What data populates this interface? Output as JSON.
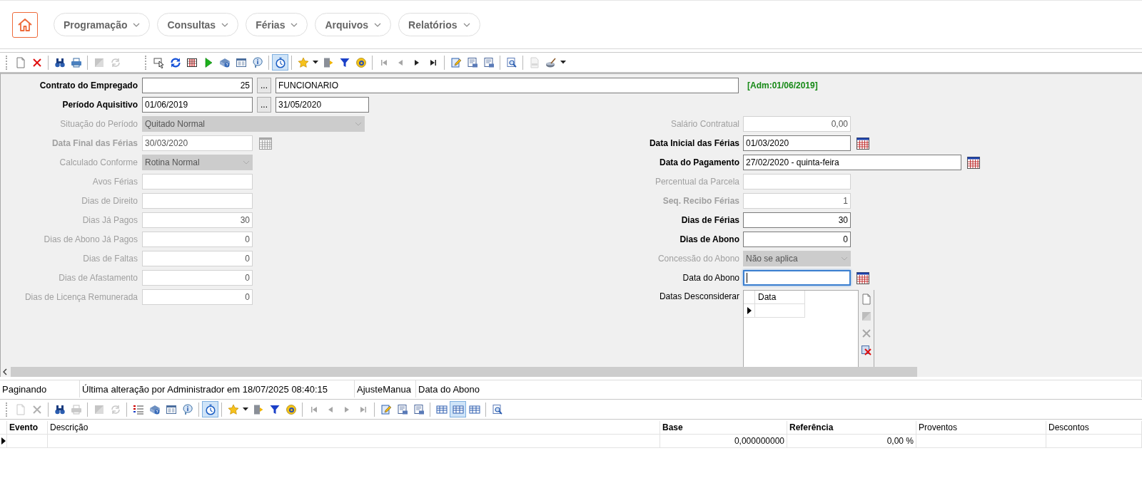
{
  "nav": {
    "menus": [
      "Programação",
      "Consultas",
      "Férias",
      "Arquivos",
      "Relatórios"
    ]
  },
  "main_toolbar": [
    {
      "kind": "new",
      "disabled": false,
      "pressed": false
    },
    {
      "kind": "delete",
      "disabled": false,
      "pressed": false
    },
    {
      "kind": "sep"
    },
    {
      "kind": "find",
      "disabled": false,
      "pressed": false
    },
    {
      "kind": "print",
      "disabled": false,
      "pressed": false
    },
    {
      "kind": "sep"
    },
    {
      "kind": "save",
      "disabled": true,
      "pressed": false
    },
    {
      "kind": "refresh",
      "disabled": true,
      "pressed": false
    },
    {
      "kind": "gap"
    },
    {
      "kind": "pointer",
      "disabled": false,
      "pressed": false
    },
    {
      "kind": "sync",
      "disabled": false,
      "pressed": false
    },
    {
      "kind": "columns",
      "disabled": false,
      "pressed": false
    },
    {
      "kind": "play",
      "disabled": false,
      "pressed": false
    },
    {
      "kind": "help",
      "disabled": false,
      "pressed": false
    },
    {
      "kind": "form",
      "disabled": false,
      "pressed": false
    },
    {
      "kind": "info",
      "disabled": false,
      "pressed": false
    },
    {
      "kind": "sep"
    },
    {
      "kind": "timer",
      "disabled": false,
      "pressed": true
    },
    {
      "kind": "sep"
    },
    {
      "kind": "star",
      "disabled": false,
      "pressed": false
    },
    {
      "kind": "caret",
      "disabled": false,
      "pressed": false
    },
    {
      "kind": "exit",
      "disabled": false,
      "pressed": false
    },
    {
      "kind": "filter",
      "disabled": false,
      "pressed": false
    },
    {
      "kind": "ring",
      "disabled": false,
      "pressed": false
    },
    {
      "kind": "sep"
    },
    {
      "kind": "first",
      "disabled": true,
      "pressed": false
    },
    {
      "kind": "prev",
      "disabled": true,
      "pressed": false
    },
    {
      "kind": "next",
      "disabled": false,
      "pressed": false
    },
    {
      "kind": "last",
      "disabled": false,
      "pressed": false
    },
    {
      "kind": "sep"
    },
    {
      "kind": "edit",
      "disabled": false,
      "pressed": false
    },
    {
      "kind": "report",
      "disabled": false,
      "pressed": false
    },
    {
      "kind": "report",
      "disabled": false,
      "pressed": false
    },
    {
      "kind": "sep"
    },
    {
      "kind": "preview",
      "disabled": false,
      "pressed": false
    },
    {
      "kind": "sep"
    },
    {
      "kind": "page",
      "disabled": true,
      "pressed": false
    },
    {
      "kind": "brush",
      "disabled": false,
      "pressed": false
    },
    {
      "kind": "caret",
      "disabled": false,
      "pressed": false
    }
  ],
  "form": {
    "top_rows": [
      {
        "label": "Contrato do Empregado",
        "kind": "lookup",
        "bold": true,
        "disabled": false,
        "value": "25",
        "button_label": "...",
        "description": "FUNCIONARIO",
        "note": "[Adm:01/06/2019]"
      },
      {
        "label": "Período Aquisitivo",
        "kind": "range",
        "bold": true,
        "disabled": false,
        "value": "01/06/2019",
        "button_label": "...",
        "value_end": "31/05/2020"
      }
    ],
    "left_rows": [
      {
        "label": "Situação do Período",
        "kind": "longcombo",
        "bold": false,
        "disabled": true,
        "value": "Quitado Normal"
      },
      {
        "label": "Data Final das Férias",
        "kind": "date",
        "bold": true,
        "disabled": true,
        "value": "30/03/2020"
      },
      {
        "label": "Calculado Conforme",
        "kind": "combo",
        "bold": false,
        "disabled": true,
        "value": "Rotina Normal"
      },
      {
        "label": "Avos Férias",
        "kind": "number",
        "bold": false,
        "disabled": true
      },
      {
        "label": "Dias de Direito",
        "kind": "number",
        "bold": false,
        "disabled": true
      },
      {
        "label": "Dias Já Pagos",
        "kind": "number",
        "bold": false,
        "disabled": true,
        "value": "30"
      },
      {
        "label": "Dias de Abono Já Pagos",
        "kind": "number",
        "bold": false,
        "disabled": true,
        "value": "0"
      },
      {
        "label": "Dias de Faltas",
        "kind": "number",
        "bold": false,
        "disabled": true,
        "value": "0"
      },
      {
        "label": "Dias de Afastamento",
        "kind": "number",
        "bold": false,
        "disabled": true,
        "value": "0"
      },
      {
        "label": "Dias de Licença Remunerada",
        "kind": "number",
        "bold": false,
        "disabled": true,
        "value": "0"
      }
    ],
    "right_rows": [
      {
        "label": "Salário Contratual",
        "kind": "number",
        "bold": false,
        "disabled": true,
        "value": "0,00"
      },
      {
        "label": "Data Inicial das Férias",
        "kind": "date",
        "bold": true,
        "disabled": false,
        "value": "01/03/2020"
      },
      {
        "label": "Data do Pagamento",
        "kind": "longdate",
        "bold": true,
        "disabled": false,
        "value": "27/02/2020 - quinta-feira"
      },
      {
        "label": "Percentual da Parcela",
        "kind": "number",
        "bold": false,
        "disabled": true
      },
      {
        "label": "Seq. Recibo Férias",
        "kind": "number",
        "bold": true,
        "disabled": true,
        "value": "1"
      },
      {
        "label": "Dias de Férias",
        "kind": "number",
        "bold": true,
        "disabled": false,
        "value": "30"
      },
      {
        "label": "Dias de Abono",
        "kind": "number",
        "bold": true,
        "disabled": false,
        "value": "0"
      },
      {
        "label": "Concessão do Abono",
        "kind": "combo",
        "bold": false,
        "disabled": true,
        "value": "Não se aplica"
      },
      {
        "label": "Data do Abono",
        "kind": "date",
        "bold": false,
        "disabled": false,
        "focused": true
      }
    ],
    "excluded_dates": {
      "label": "Datas Desconsiderar",
      "column": "Data",
      "rows": [
        {
          "current": true
        }
      ],
      "tools": [
        {
          "kind": "new",
          "disabled": false
        },
        {
          "kind": "save",
          "disabled": true
        },
        {
          "kind": "delete",
          "disabled": true
        },
        {
          "kind": "clear",
          "disabled": false
        }
      ]
    }
  },
  "status_bar": [
    "Paginando",
    "Última alteração por Administrador em 18/07/2025 08:40:15",
    "AjusteManua",
    "Data do Abono"
  ],
  "events_toolbar": [
    {
      "kind": "new",
      "disabled": true,
      "pressed": false
    },
    {
      "kind": "delete",
      "disabled": true,
      "pressed": false
    },
    {
      "kind": "sep"
    },
    {
      "kind": "find",
      "disabled": false,
      "pressed": false
    },
    {
      "kind": "print",
      "disabled": true,
      "pressed": false
    },
    {
      "kind": "sep"
    },
    {
      "kind": "save",
      "disabled": true,
      "pressed": false
    },
    {
      "kind": "refresh",
      "disabled": true,
      "pressed": false
    },
    {
      "kind": "sep"
    },
    {
      "kind": "list",
      "disabled": false,
      "pressed": false
    },
    {
      "kind": "help",
      "disabled": false,
      "pressed": false
    },
    {
      "kind": "form",
      "disabled": false,
      "pressed": false
    },
    {
      "kind": "info",
      "disabled": false,
      "pressed": false
    },
    {
      "kind": "sep"
    },
    {
      "kind": "timer",
      "disabled": false,
      "pressed": true
    },
    {
      "kind": "sep"
    },
    {
      "kind": "star",
      "disabled": false,
      "pressed": false
    },
    {
      "kind": "caret",
      "disabled": false,
      "pressed": false
    },
    {
      "kind": "exit",
      "disabled": false,
      "pressed": false
    },
    {
      "kind": "filter",
      "disabled": false,
      "pressed": false
    },
    {
      "kind": "ring",
      "disabled": false,
      "pressed": false
    },
    {
      "kind": "sep"
    },
    {
      "kind": "first",
      "disabled": true,
      "pressed": false
    },
    {
      "kind": "prev",
      "disabled": true,
      "pressed": false
    },
    {
      "kind": "next",
      "disabled": true,
      "pressed": false
    },
    {
      "kind": "last",
      "disabled": true,
      "pressed": false
    },
    {
      "kind": "sep"
    },
    {
      "kind": "edit",
      "disabled": false,
      "pressed": false
    },
    {
      "kind": "report",
      "disabled": false,
      "pressed": false
    },
    {
      "kind": "report",
      "disabled": false,
      "pressed": false
    },
    {
      "kind": "sep"
    },
    {
      "kind": "table",
      "disabled": false,
      "pressed": false
    },
    {
      "kind": "table",
      "disabled": false,
      "pressed": true
    },
    {
      "kind": "table",
      "disabled": false,
      "pressed": false
    },
    {
      "kind": "sep"
    },
    {
      "kind": "preview",
      "disabled": false,
      "pressed": false
    }
  ],
  "events_table": {
    "columns": [
      {
        "label": "Evento",
        "bold": true
      },
      {
        "label": "Descrição",
        "bold": false
      },
      {
        "label": "Base",
        "bold": true
      },
      {
        "label": "Referência",
        "bold": true
      },
      {
        "label": "Proventos",
        "bold": false
      },
      {
        "label": "Descontos",
        "bold": false
      }
    ],
    "rows": [
      {
        "current": true,
        "base": "0,000000000",
        "reference": "0,00 %"
      }
    ]
  }
}
